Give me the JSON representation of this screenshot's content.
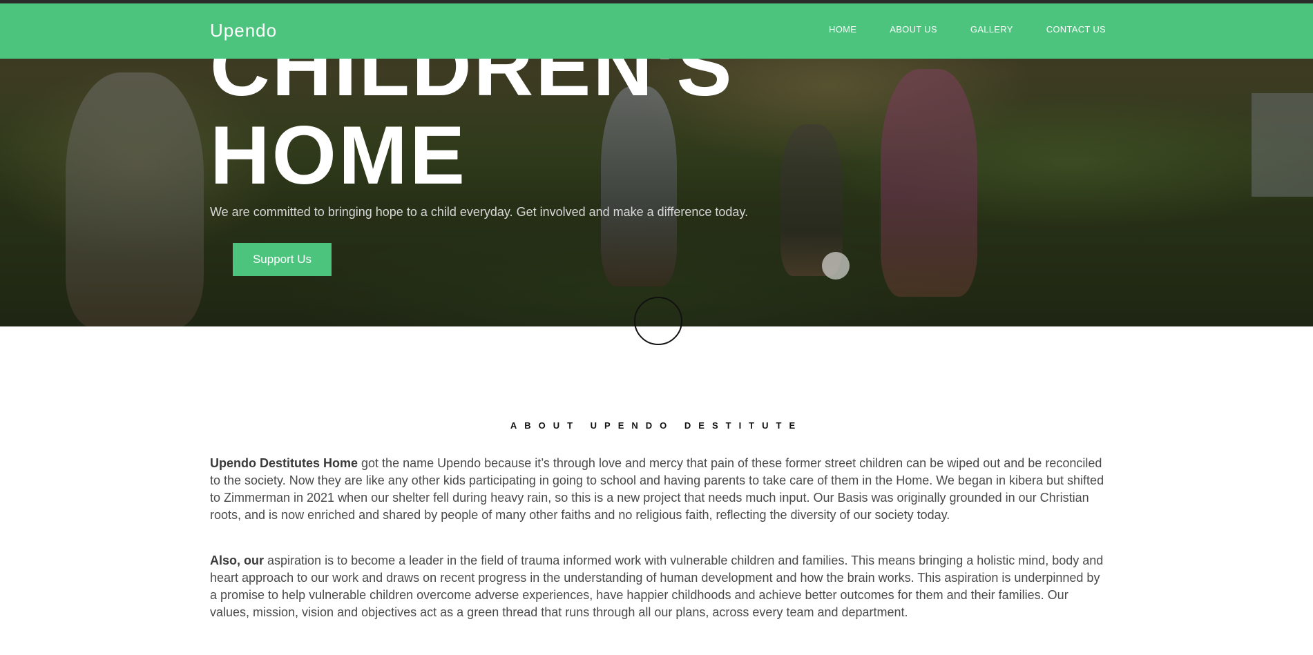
{
  "brand": "Upendo",
  "nav": [
    "HOME",
    "ABOUT US",
    "GALLERY",
    "CONTACT US"
  ],
  "hero": {
    "title_line1": "CHILDREN'S",
    "title_line2": "HOME",
    "subtitle": "We are committed to bringing hope to a child everyday. Get involved and make a difference today.",
    "cta": "Support Us"
  },
  "about": {
    "heading": "ABOUT UPENDO DESTITUTE",
    "p1_bold": "Upendo Destitutes Home",
    "p1_text": " got the name Upendo because it’s through love and mercy that pain of these former street children can be wiped out and be reconciled to the society. Now they are like any other kids participating in going to school and having parents to take care of them in the Home. We began in kibera but shifted to Zimmerman in 2021 when our shelter fell during heavy rain, so this is a new project that needs much input. Our Basis was originally grounded in our Christian roots, and is now enriched and shared by people of many other faiths and no religious faith, reflecting the diversity of our society today.",
    "p2_bold": "Also, our",
    "p2_text": " aspiration is to become a leader in the field of trauma informed work with vulnerable children and families. This means bringing a holistic mind, body and heart approach to our work and draws on recent progress in the understanding of human development and how the brain works. This aspiration is underpinned by a promise to help vulnerable children overcome adverse experiences, have happier childhoods and achieve better outcomes for them and their families. Our values, mission, vision and objectives act as a green thread that runs through all our plans, across every team and department."
  },
  "colors": {
    "accent": "#4dc47d",
    "text": "#4a4a4a"
  }
}
